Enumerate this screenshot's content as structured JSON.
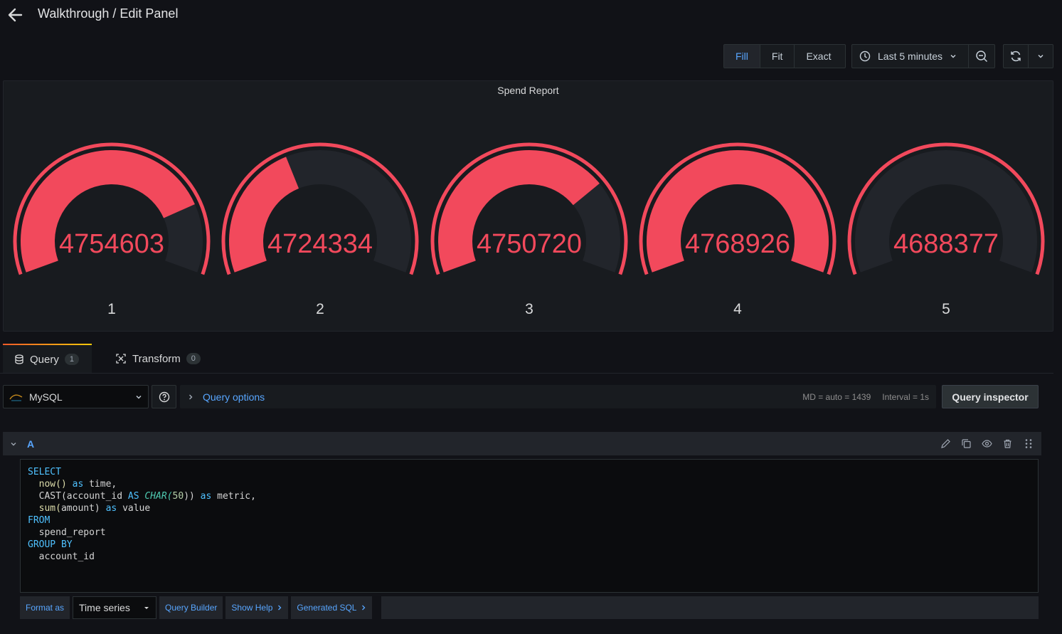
{
  "header": {
    "title": "Walkthrough / Edit Panel"
  },
  "toolbar": {
    "view_modes": [
      "Fill",
      "Fit",
      "Exact"
    ],
    "active_mode": "Fill",
    "time_range": "Last 5 minutes"
  },
  "panel": {
    "title": "Spend Report",
    "gauges": [
      {
        "value": "4754603",
        "label": "1",
        "fill_fraction": 0.8
      },
      {
        "value": "4724334",
        "label": "2",
        "fill_fraction": 0.4
      },
      {
        "value": "4750720",
        "label": "3",
        "fill_fraction": 0.73
      },
      {
        "value": "4768926",
        "label": "4",
        "fill_fraction": 1.0
      },
      {
        "value": "4688377",
        "label": "5",
        "fill_fraction": 0.0
      }
    ],
    "colors": {
      "value": "#f2495c",
      "track": "#22252b"
    }
  },
  "tabs": [
    {
      "label": "Query",
      "count": "1"
    },
    {
      "label": "Transform",
      "count": "0"
    }
  ],
  "query_row": {
    "datasource": "MySQL",
    "options_label": "Query options",
    "md": "MD = auto = 1439",
    "interval": "Interval = 1s",
    "inspector": "Query inspector"
  },
  "query": {
    "ref_id": "A",
    "sql": {
      "select": "SELECT",
      "now": "now()",
      "as1": "as",
      "time": "time,",
      "cast": "CAST(",
      "account_id": "account_id",
      "as2": "AS",
      "char": "CHAR(",
      "fifty": "50",
      "close": "))",
      "as3": "as",
      "metric": "metric,",
      "sum": "sum(",
      "amount": "amount)",
      "as4": "as",
      "value": "value",
      "from": "FROM",
      "table": "spend_report",
      "group_by": "GROUP BY",
      "group_col": "account_id"
    }
  },
  "bottom": {
    "format_label": "Format as",
    "format_value": "Time series",
    "builder": "Query Builder",
    "help": "Show Help",
    "generated": "Generated SQL"
  }
}
